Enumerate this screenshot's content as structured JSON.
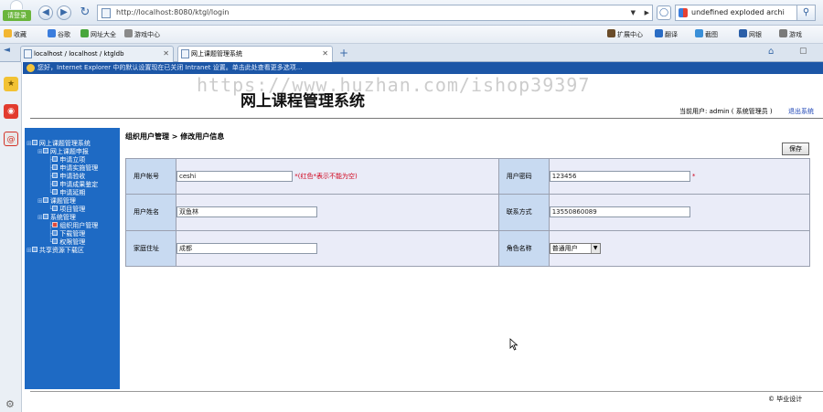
{
  "browser": {
    "login_label": "请登录",
    "url": "http://localhost:8080/ktgl/login",
    "search_text": "undefined exploded archi",
    "bookmarks": {
      "favorites": "收藏",
      "google": "谷歌",
      "nav": "网址大全",
      "games": "游戏中心",
      "extensions": "扩展中心",
      "translate": "翻译",
      "screenshot": "截图",
      "netbank": "网银",
      "game2": "游戏"
    },
    "tabs": [
      {
        "label": "localhost / localhost / ktgldb"
      },
      {
        "label": "网上课题管理系统"
      }
    ],
    "info_bar": "您好，Internet Explorer 中的默认设置现在已关闭 Intranet 设置。单击此处查看更多选项..."
  },
  "watermark": "https://www.huzhan.com/ishop39397",
  "header": {
    "title": "网上课程管理系统",
    "user_info": "当前用户: admin ( 系统管理员 )",
    "logout": "退出系统"
  },
  "sidebar": {
    "items": [
      {
        "label": "网上课题管理系统"
      },
      {
        "label": "网上课题申报"
      },
      {
        "label": "申请立项"
      },
      {
        "label": "申请实施管理"
      },
      {
        "label": "申请验收"
      },
      {
        "label": "申请成果鉴定"
      },
      {
        "label": "申请延期"
      },
      {
        "label": "课题管理"
      },
      {
        "label": "项目管理"
      },
      {
        "label": "系统管理"
      },
      {
        "label": "组织用户管理"
      },
      {
        "label": "下载管理"
      },
      {
        "label": "权限管理"
      },
      {
        "label": "共享资源下载区"
      }
    ]
  },
  "content": {
    "breadcrumb": "组织用户管理 > 修改用户信息",
    "save_label": "保存",
    "form": {
      "account_label": "用户帐号",
      "account_value": "ceshi",
      "required_note": "*(红色*表示不能为空)",
      "password_label": "用户密码",
      "password_value": "123456",
      "password_star": "*",
      "name_label": "用户姓名",
      "name_value": "双鱼林",
      "contact_label": "联系方式",
      "contact_value": "13550860089",
      "address_label": "家庭住址",
      "address_value": "成都",
      "role_label": "角色名称",
      "role_value": "普通用户"
    }
  },
  "footer": {
    "copyright": "© 毕业设计"
  }
}
